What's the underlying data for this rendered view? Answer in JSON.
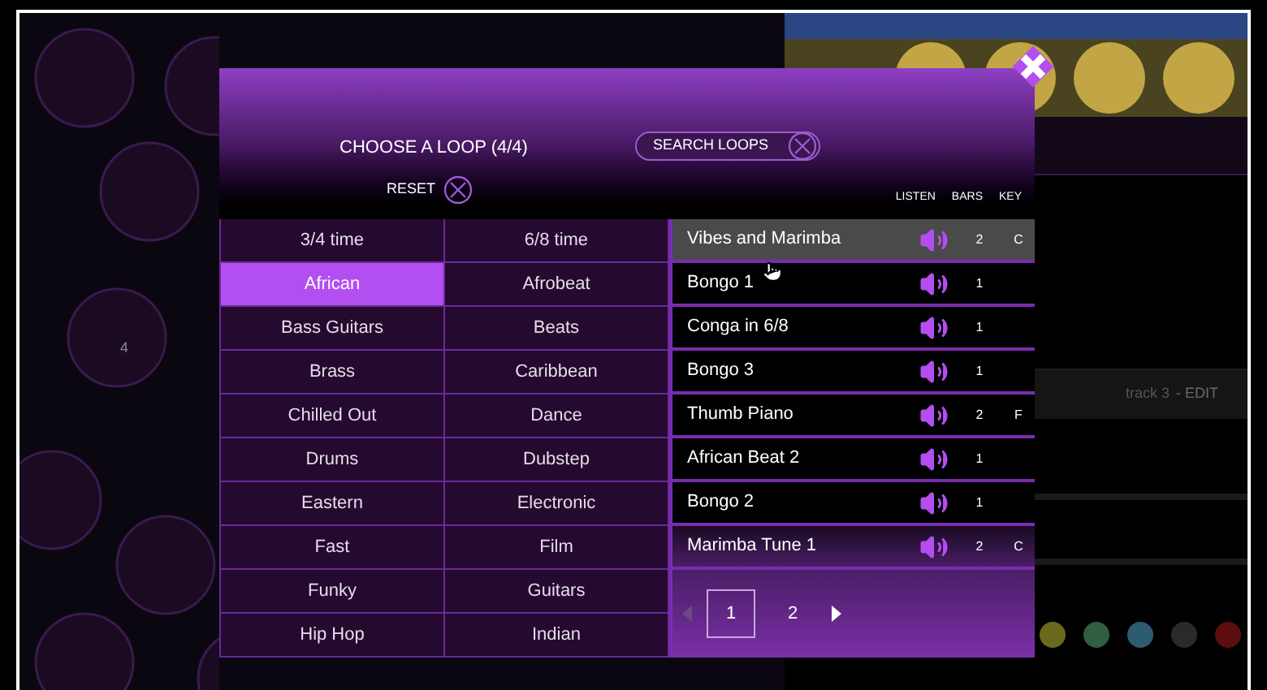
{
  "background": {
    "side_label": "4",
    "track_label": "track 3",
    "track_action": "- EDIT"
  },
  "title": "CHOOSE A LOOP (4/4)",
  "search": {
    "placeholder": "SEARCH LOOPS"
  },
  "reset": "RESET",
  "columns": [
    "LISTEN",
    "BARS",
    "KEY"
  ],
  "categories": [
    {
      "label": "3/4 time",
      "selected": false
    },
    {
      "label": "6/8 time",
      "selected": false
    },
    {
      "label": "African",
      "selected": true
    },
    {
      "label": "Afrobeat",
      "selected": false
    },
    {
      "label": "Bass Guitars",
      "selected": false
    },
    {
      "label": "Beats",
      "selected": false
    },
    {
      "label": "Brass",
      "selected": false
    },
    {
      "label": "Caribbean",
      "selected": false
    },
    {
      "label": "Chilled Out",
      "selected": false
    },
    {
      "label": "Dance",
      "selected": false
    },
    {
      "label": "Drums",
      "selected": false
    },
    {
      "label": "Dubstep",
      "selected": false
    },
    {
      "label": "Eastern",
      "selected": false
    },
    {
      "label": "Electronic",
      "selected": false
    },
    {
      "label": "Fast",
      "selected": false
    },
    {
      "label": "Film",
      "selected": false
    },
    {
      "label": "Funky",
      "selected": false
    },
    {
      "label": "Guitars",
      "selected": false
    },
    {
      "label": "Hip Hop",
      "selected": false
    },
    {
      "label": "Indian",
      "selected": false
    }
  ],
  "loops": [
    {
      "name": "Vibes and Marimba",
      "bars": "2",
      "key": "C",
      "selected": true
    },
    {
      "name": "Bongo 1",
      "bars": "1",
      "selected": false
    },
    {
      "name": "Conga in 6/8",
      "bars": "1",
      "selected": false
    },
    {
      "name": "Bongo 3",
      "bars": "1",
      "selected": false
    },
    {
      "name": "Thumb Piano",
      "bars": "2",
      "key": "F",
      "selected": false
    },
    {
      "name": "African Beat 2",
      "bars": "1",
      "selected": false
    },
    {
      "name": "Bongo 2",
      "bars": "1",
      "selected": false
    },
    {
      "name": "Marimba Tune 1",
      "bars": "2",
      "key": "C",
      "selected": false
    }
  ],
  "pagination": {
    "previous": {
      "disabled": true
    },
    "pages": [
      {
        "label": "1",
        "selected": true
      },
      {
        "label": "2",
        "selected": false
      }
    ],
    "next": {
      "disabled": false
    }
  }
}
